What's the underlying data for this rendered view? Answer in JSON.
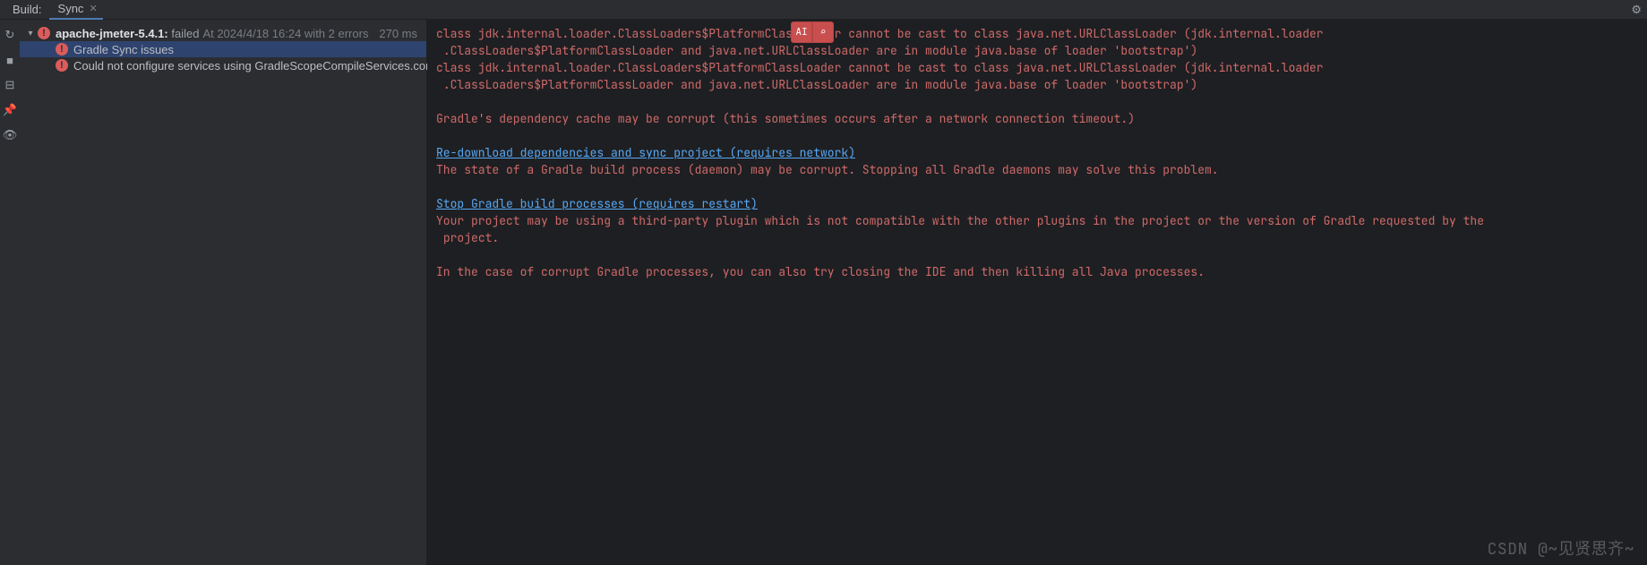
{
  "header": {
    "panel_label": "Build:",
    "tab_label": "Sync",
    "gear_title": "Settings"
  },
  "gutter": {
    "refresh": "↻",
    "stop": "■",
    "collapse": "⊟",
    "pin": "📌",
    "show": "👁"
  },
  "tree": {
    "root": {
      "name": "apache-jmeter-5.4.1:",
      "status": "failed",
      "meta": "At 2024/4/18 16:24 with 2 errors",
      "duration": "270 ms"
    },
    "children": [
      {
        "label": "Gradle Sync issues"
      },
      {
        "label": "Could not configure services using GradleScopeCompileServices.configure()"
      }
    ]
  },
  "console": {
    "err1": "class jdk.internal.loader.ClassLoaders$PlatformClassLoader cannot be cast to class java.net.URLClassLoader (jdk.internal.loader\n .ClassLoaders$PlatformClassLoader and java.net.URLClassLoader are in module java.base of loader 'bootstrap')",
    "err2": "class jdk.internal.loader.ClassLoaders$PlatformClassLoader cannot be cast to class java.net.URLClassLoader (jdk.internal.loader\n .ClassLoaders$PlatformClassLoader and java.net.URLClassLoader are in module java.base of loader 'bootstrap')",
    "err3": "Gradle's dependency cache may be corrupt (this sometimes occurs after a network connection timeout.)",
    "link1": "Re-download dependencies and sync project (requires network)",
    "err4": "The state of a Gradle build process (daemon) may be corrupt. Stopping all Gradle daemons may solve this problem.",
    "link2": "Stop Gradle build processes (requires restart)",
    "err5": "Your project may be using a third-party plugin which is not compatible with the other plugins in the project or the version of Gradle requested by the\n project.",
    "err6": "In the case of corrupt Gradle processes, you can also try closing the IDE and then killing all Java processes."
  },
  "float": {
    "ai_label": "AI",
    "search_label": "⌕"
  },
  "watermark": "CSDN @~见贤思齐~"
}
